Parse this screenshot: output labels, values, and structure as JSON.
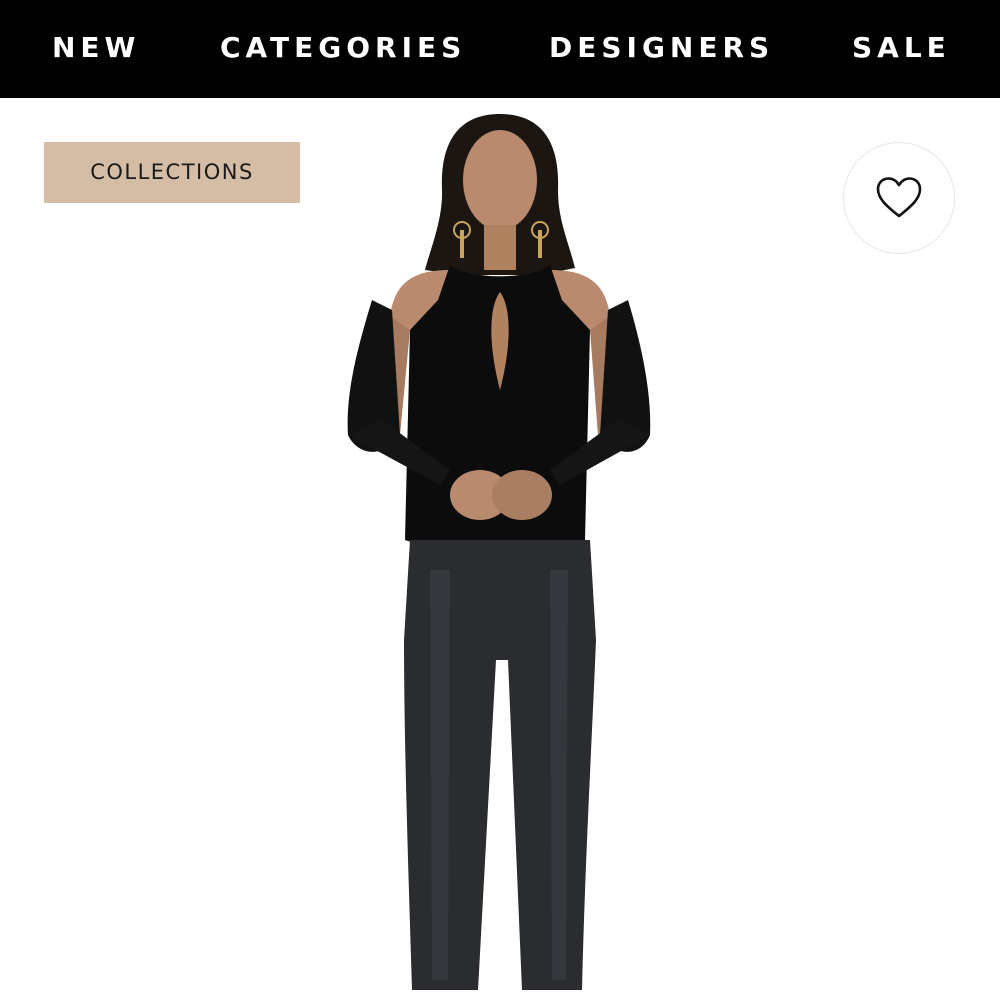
{
  "nav": {
    "items": [
      {
        "label": "NEW"
      },
      {
        "label": "CATEGORIES"
      },
      {
        "label": "DESIGNERS"
      },
      {
        "label": "SALE"
      }
    ]
  },
  "product": {
    "tag_label": "COLLECTIONS",
    "favorite_icon": "heart-outline-icon"
  },
  "colors": {
    "nav_background": "#000000",
    "nav_text": "#ffffff",
    "tag_background": "#d5bca4",
    "page_background": "#ffffff"
  }
}
